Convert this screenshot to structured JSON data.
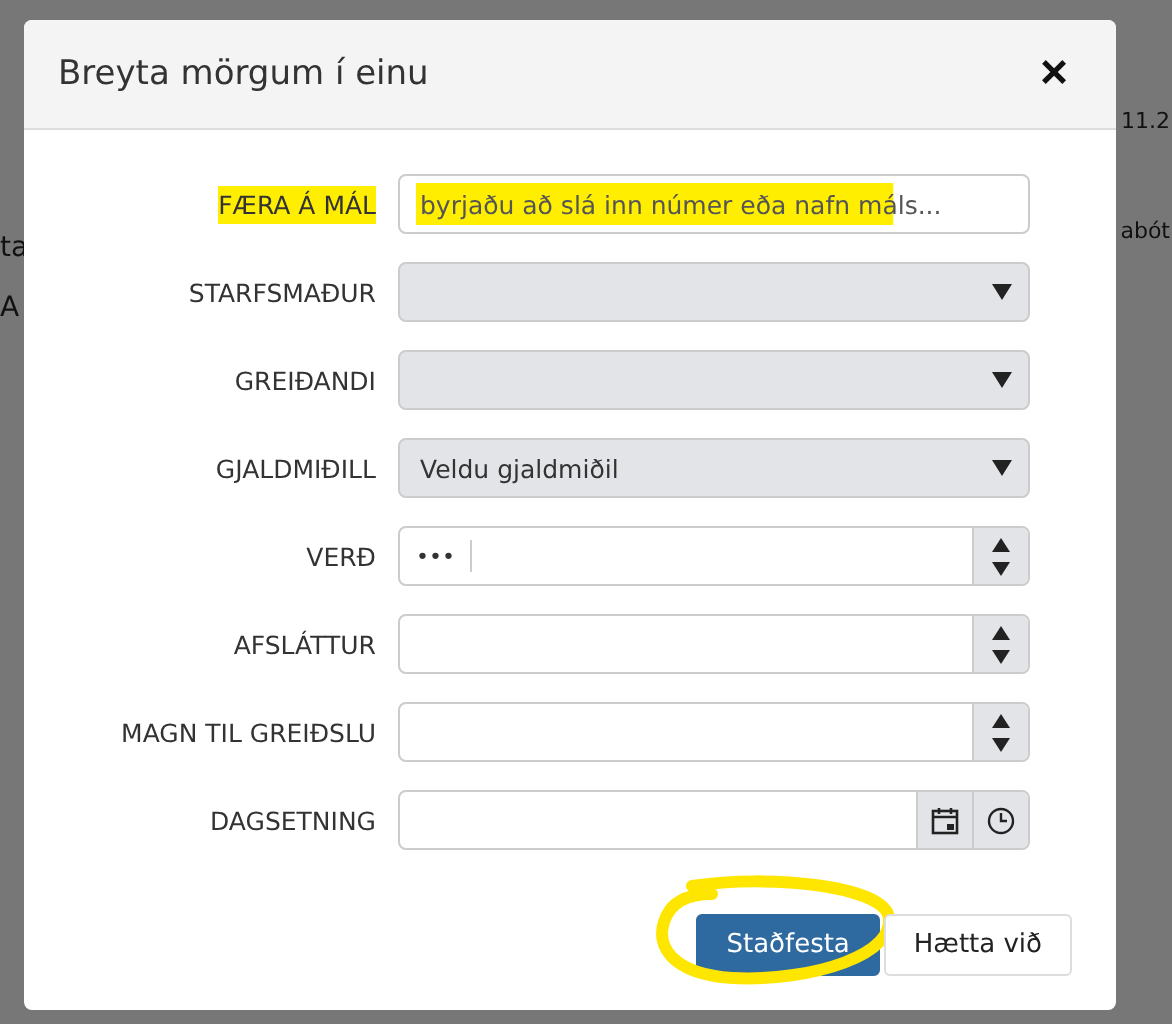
{
  "background": {
    "left_texts": [
      "ta",
      "A"
    ],
    "right_texts": [
      "11.2",
      "abót"
    ]
  },
  "dialog": {
    "title": "Breyta mörgum í einu",
    "close": "×",
    "fields": [
      {
        "label": "FÆRA Á MÁL",
        "kind": "text",
        "placeholder": "byrjaðu að slá inn númer eða nafn máls...",
        "highlighted": true
      },
      {
        "label": "STARFSMAÐUR",
        "kind": "select",
        "highlighted": false
      },
      {
        "label": "GREIÐANDI",
        "kind": "select",
        "highlighted": false
      },
      {
        "label": "GJALDMIÐILL",
        "kind": "select",
        "value": "Veldu gjaldmiðil",
        "highlighted": false
      },
      {
        "label": "VERÐ",
        "kind": "number",
        "prefix": "•••",
        "highlighted": false
      },
      {
        "label": "AFSLÁTTUR",
        "kind": "number",
        "highlighted": false
      },
      {
        "label": "MAGN TIL GREIÐSLU",
        "kind": "number",
        "highlighted": false
      },
      {
        "label": "DAGSETNING",
        "kind": "datetime",
        "highlighted": false
      }
    ],
    "buttons": [
      {
        "label": "Staðfesta",
        "kind": "primary",
        "circled": true
      },
      {
        "label": "Hætta við",
        "kind": "secondary",
        "circled": false
      }
    ]
  }
}
